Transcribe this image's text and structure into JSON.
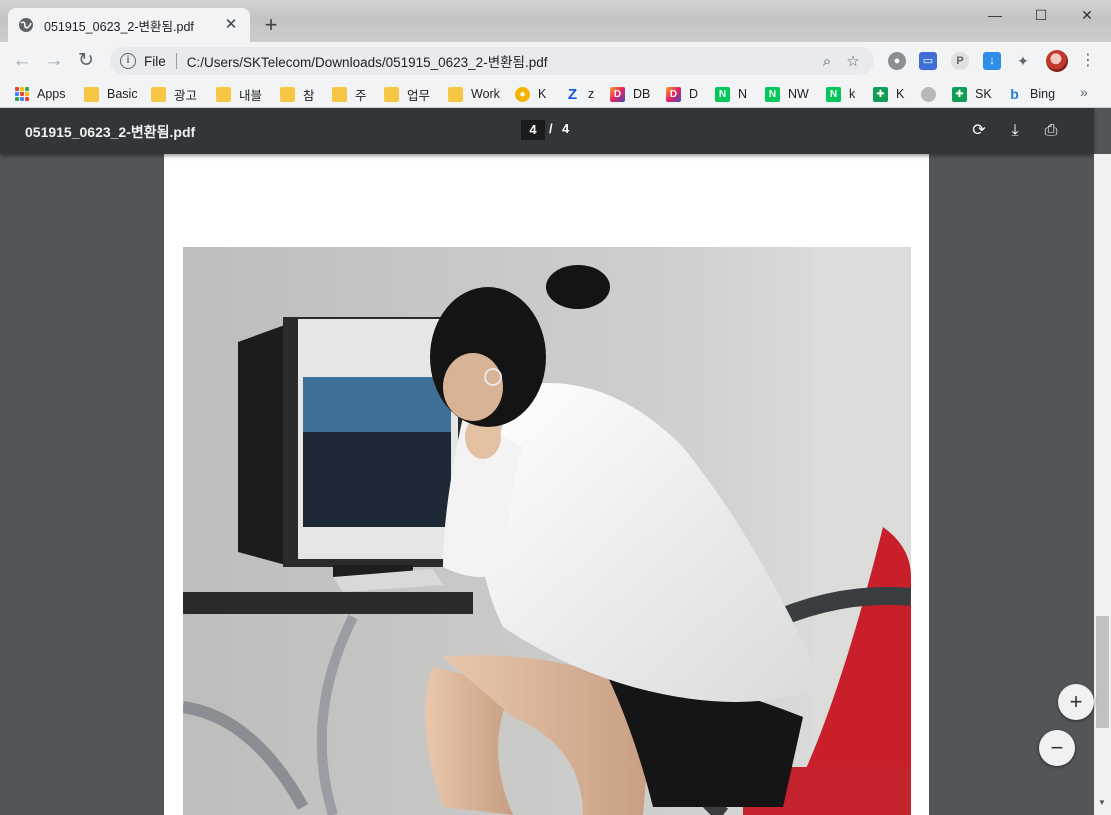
{
  "tab": {
    "title": "051915_0623_2-변환됨.pdf",
    "close": "✕"
  },
  "window": {
    "new_tab": "+",
    "minimize": "—",
    "maximize": "☐",
    "close": "✕"
  },
  "toolbar": {
    "back": "←",
    "forward": "→",
    "reload": "↻",
    "info": "i",
    "scheme": "File",
    "url": "C:/Users/SKTelecom/Downloads/051915_0623_2-변환됨.pdf",
    "zoom_icon": "⌕",
    "star_icon": "☆",
    "menu": "⋮"
  },
  "bookmarks": {
    "items": [
      {
        "label": "Apps"
      },
      {
        "label": "Basic"
      },
      {
        "label": "광고"
      },
      {
        "label": "내블"
      },
      {
        "label": "참"
      },
      {
        "label": "주"
      },
      {
        "label": "업무"
      },
      {
        "label": "Work"
      },
      {
        "label": "K"
      },
      {
        "label": "z"
      },
      {
        "label": "DB"
      },
      {
        "label": "D"
      },
      {
        "label": "N"
      },
      {
        "label": "NW"
      },
      {
        "label": "k"
      },
      {
        "label": "K"
      },
      {
        "label": "SK"
      },
      {
        "label": "Bing"
      }
    ],
    "more": "»"
  },
  "pdf": {
    "title": "051915_0623_2-변환됨.pdf",
    "current_page": "4",
    "separator": "/",
    "total_pages": "4",
    "rotate": "⟳",
    "download": "⤓",
    "print": "⎙",
    "zoom_in": "+",
    "zoom_out": "−"
  },
  "colors": {
    "pdf_toolbar": "#323639",
    "viewer_bg": "#525659",
    "tab_active": "#f1f3f4"
  }
}
